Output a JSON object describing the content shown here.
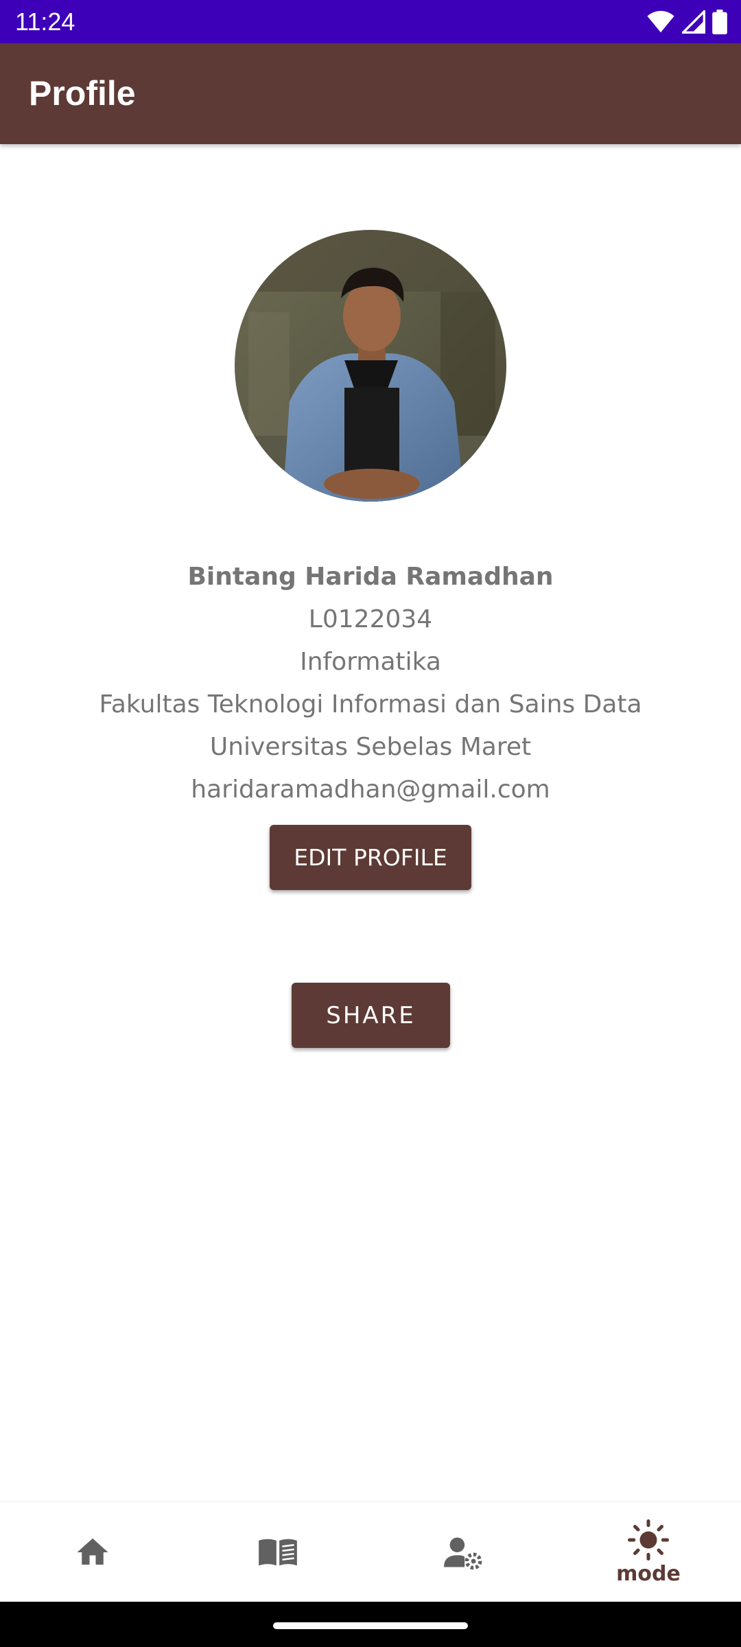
{
  "status_bar": {
    "time": "11:24",
    "color": "#3d00b8",
    "icons": [
      "wifi-icon",
      "signal-icon",
      "battery-icon"
    ]
  },
  "app_bar": {
    "title": "Profile",
    "color": "#5d3a35"
  },
  "profile": {
    "avatar_icon": "profile-photo",
    "name": "Bintang Harida Ramadhan",
    "student_id": "L0122034",
    "major": "Informatika",
    "faculty": "Fakultas Teknologi Informasi dan Sains Data",
    "university": "Universitas Sebelas Maret",
    "email": "haridaramadhan@gmail.com"
  },
  "buttons": {
    "edit_profile": "EDIT PROFILE",
    "share": "SHARE"
  },
  "bottom_nav": {
    "items": [
      {
        "icon": "home-icon",
        "label": ""
      },
      {
        "icon": "book-icon",
        "label": ""
      },
      {
        "icon": "user-settings-icon",
        "label": ""
      },
      {
        "icon": "sun-icon",
        "label": "mode"
      }
    ],
    "active_index": 3,
    "inactive_color": "#616161",
    "active_color": "#5d3a35"
  }
}
